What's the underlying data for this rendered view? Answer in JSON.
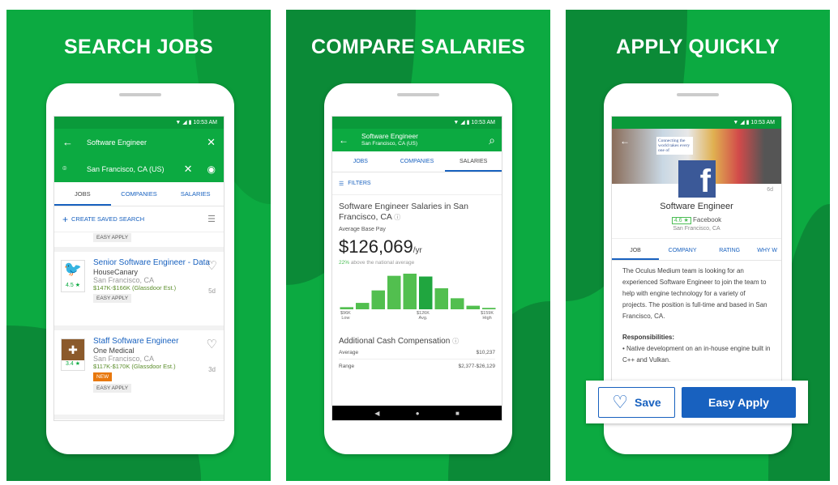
{
  "panels": [
    {
      "title": "SEARCH JOBS"
    },
    {
      "title": "COMPARE SALARIES"
    },
    {
      "title": "APPLY QUICKLY"
    }
  ],
  "status_time": "10:53 AM",
  "search": {
    "query": "Software Engineer",
    "location": "San Francisco, CA (US)",
    "tabs": [
      "JOBS",
      "COMPANIES",
      "SALARIES"
    ],
    "create_saved_search": "CREATE SAVED SEARCH",
    "top_tag": "EASY APPLY",
    "jobs": [
      {
        "title": "Senior Software Engineer - Data",
        "company": "HouseCanary",
        "location": "San Francisco, CA",
        "salary": "$147K-$166K (Glassdoor Est.)",
        "rating": "4.5 ★",
        "age": "5d",
        "new": "",
        "tag": "EASY APPLY"
      },
      {
        "title": "Staff Software Engineer",
        "company": "One Medical",
        "location": "San Francisco, CA",
        "salary": "$117K-$170K (Glassdoor Est.)",
        "rating": "3.4 ★",
        "age": "3d",
        "new": "NEW",
        "tag": "EASY APPLY"
      }
    ]
  },
  "salaries": {
    "title": "Software Engineer",
    "subtitle": "San Francisco, CA (US)",
    "tabs": [
      "JOBS",
      "COMPANIES",
      "SALARIES"
    ],
    "filters": "FILTERS",
    "heading": "Software Engineer Salaries in San Francisco, CA",
    "avg_label": "Average Base Pay",
    "avg_value": "$126,069",
    "per": "/yr",
    "pct": "22%",
    "pct_text": " above the national average",
    "chart_data": {
      "type": "bar",
      "values": [
        6,
        18,
        53,
        94,
        100,
        92,
        59,
        31,
        10,
        4
      ],
      "highlight_index": 5,
      "tick_labels": [
        {
          "v": "$96K",
          "s": "Low"
        },
        {
          "v": "$126K",
          "s": "Avg."
        },
        {
          "v": "$159K",
          "s": "High"
        }
      ]
    },
    "cash_heading": "Additional Cash Compensation",
    "cash_rows": [
      {
        "k": "Average",
        "v": "$10,237"
      },
      {
        "k": "Range",
        "v": "$2,377-$26,129"
      }
    ]
  },
  "apply": {
    "age": "6d",
    "title": "Software Engineer",
    "rating": "4.6 ★",
    "company": "Facebook",
    "location": "San Francisco, CA",
    "tabs": [
      "JOB",
      "COMPANY",
      "RATING",
      "WHY W"
    ],
    "desc": "The Oculus Medium team is looking for an experienced Software Engineer to join the team to help with engine technology for a variety of projects. The position is full-time and based in San Francisco, CA.",
    "resp_heading": "Responsibilities:",
    "resp": "• Native development on an in-house engine built in C++ and Vulkan.",
    "save": "Save",
    "easy_apply": "Easy Apply",
    "banner_text": "Connecting the world takes every one of"
  },
  "colors": {
    "brand_green": "#0caa41",
    "link_blue": "#1861bf",
    "new_badge": "#e8780d"
  }
}
